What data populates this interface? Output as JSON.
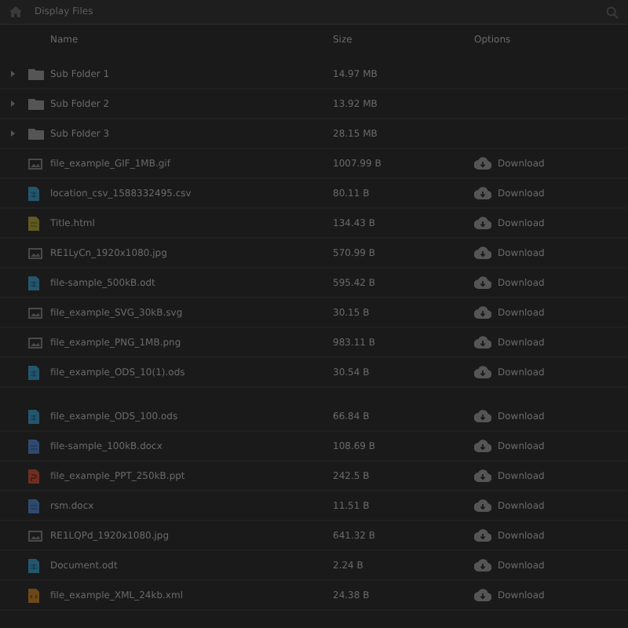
{
  "header": {
    "title": "Display Files"
  },
  "columns": [
    "Name",
    "Size",
    "Options"
  ],
  "rows": [
    {
      "kind": "folder",
      "name": "Sub Folder 1",
      "size": "14.97 MB",
      "expanded": false
    },
    {
      "kind": "folder",
      "name": "Sub Folder 2",
      "size": "13.92 MB",
      "expanded": false
    },
    {
      "kind": "folder",
      "name": "Sub Folder 3",
      "size": "28.15 MB",
      "expanded": false
    },
    {
      "kind": "image",
      "name": "file_example_GIF_1MB.gif",
      "size": "1007.99 B",
      "action": "Download"
    },
    {
      "kind": "sheet",
      "name": "location_csv_1588332495.csv",
      "size": "80.11 B",
      "action": "Download"
    },
    {
      "kind": "html",
      "name": "Title.html",
      "size": "134.43 B",
      "action": "Download"
    },
    {
      "kind": "image",
      "name": "RE1LyCn_1920x1080.jpg",
      "size": "570.99 B",
      "action": "Download"
    },
    {
      "kind": "sheet",
      "name": "file-sample_500kB.odt",
      "size": "595.42 B",
      "action": "Download"
    },
    {
      "kind": "image",
      "name": "file_example_SVG_30kB.svg",
      "size": "30.15 B",
      "action": "Download"
    },
    {
      "kind": "image",
      "name": "file_example_PNG_1MB.png",
      "size": "983.11 B",
      "action": "Download"
    },
    {
      "kind": "sheet",
      "name": "file_example_ODS_10(1).ods",
      "size": "30.54 B",
      "action": "Download"
    },
    {
      "kind": "spacer"
    },
    {
      "kind": "sheet",
      "name": "file_example_ODS_100.ods",
      "size": "66.84 B",
      "action": "Download"
    },
    {
      "kind": "doc",
      "name": "file-sample_100kB.docx",
      "size": "108.69 B",
      "action": "Download"
    },
    {
      "kind": "ppt",
      "name": "file_example_PPT_250kB.ppt",
      "size": "242.5 B",
      "action": "Download"
    },
    {
      "kind": "doc",
      "name": "rsm.docx",
      "size": "11.51 B",
      "action": "Download"
    },
    {
      "kind": "image",
      "name": "RE1LQPd_1920x1080.jpg",
      "size": "641.32 B",
      "action": "Download"
    },
    {
      "kind": "sheet",
      "name": "Document.odt",
      "size": "2.24 B",
      "action": "Download"
    },
    {
      "kind": "xml",
      "name": "file_example_XML_24kb.xml",
      "size": "24.38 B",
      "action": "Download"
    }
  ]
}
